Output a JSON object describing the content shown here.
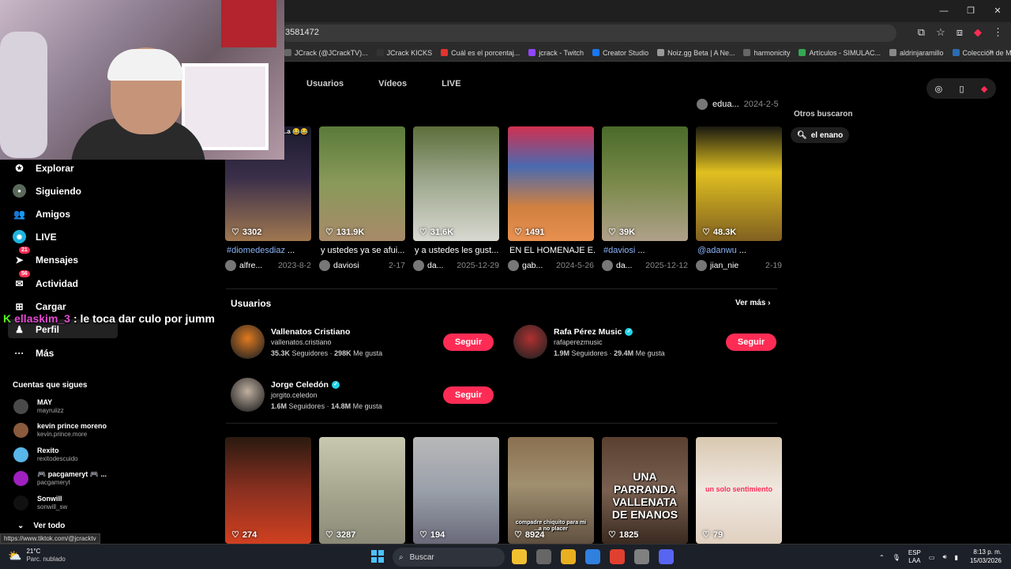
{
  "browser": {
    "url": "3581472",
    "bookmarks": [
      "JCrack (@JCrackTV)...",
      "JCrack KICKS",
      "Cuál es el porcentaj...",
      "jcrack - Twitch",
      "Creator Studio",
      "Noiz.gg Beta | A Ne...",
      "harmonicity",
      "Artículos - SIMULAC...",
      "aldrinjaramillo",
      "Colección de M_blei..."
    ],
    "bookmark_colors": [
      "#666666",
      "#333333",
      "#e3342f",
      "#9146ff",
      "#1877f2",
      "#999999",
      "#666666",
      "#34a853",
      "#888888",
      "#2b6cb0"
    ],
    "more_label": "»",
    "window_controls": [
      "—",
      "❐",
      "✕"
    ]
  },
  "tabs": [
    "Usuarios",
    "Vídeos",
    "LIVE"
  ],
  "prev_row": {
    "user": "edua...",
    "date": "2024-2-5"
  },
  "others": {
    "title": "Otros buscaron",
    "chip": "el enano"
  },
  "sidebar": {
    "items": [
      {
        "icon": "compass-icon",
        "glyph": "✪",
        "label": "Explorar",
        "badge": ""
      },
      {
        "icon": "following-avatar-icon",
        "glyph": "●",
        "label": "Siguiendo",
        "badge": ""
      },
      {
        "icon": "friends-icon",
        "glyph": "👥",
        "label": "Amigos",
        "badge": ""
      },
      {
        "icon": "live-icon",
        "glyph": "◉",
        "label": "LIVE",
        "badge": ""
      },
      {
        "icon": "messages-icon",
        "glyph": "➤",
        "label": "Mensajes",
        "badge": "21"
      },
      {
        "icon": "activity-icon",
        "glyph": "✉",
        "label": "Actividad",
        "badge": "56"
      },
      {
        "icon": "upload-icon",
        "glyph": "⊞",
        "label": "Cargar",
        "badge": ""
      },
      {
        "icon": "profile-icon",
        "glyph": "♟",
        "label": "Perfil",
        "badge": ""
      },
      {
        "icon": "more-icon",
        "glyph": "···",
        "label": "Más",
        "badge": ""
      }
    ],
    "following_title": "Cuentas que sigues",
    "accounts": [
      {
        "name": "MAY",
        "handle": "mayruiizz",
        "color": "#4a4a4a"
      },
      {
        "name": "kevin prince moreno",
        "handle": "kevin.prince.more",
        "color": "#8a5a3c"
      },
      {
        "name": "Rexito",
        "handle": "rexitodescuido",
        "color": "#59b6e8"
      },
      {
        "name": "🎮 pacgameryt 🎮 ...",
        "handle": "pacgameryt",
        "color": "#a020c0"
      },
      {
        "name": "Sonwill",
        "handle": "sonwill_sw",
        "color": "#111111"
      }
    ],
    "see_all": "Ver todo"
  },
  "chat": {
    "k": "K",
    "user": "ellaskim_3",
    "message": ": le toca dar culo por jumm"
  },
  "status_url": "https://www.tiktok.com/@jcracktv",
  "videos_row1": [
    {
      "likes": "3302",
      "caption_tag": "#diomedesdiaz",
      "caption": " ...",
      "user": "alfre...",
      "date": "2023-8-2",
      "bg": "linear-gradient(180deg,#1a1a2e 0%,#3b2f4a 45%,#a07850 100%)",
      "overlay": "...curas, ...a 😂😂"
    },
    {
      "likes": "131.9K",
      "caption_tag": "",
      "caption": "y ustedes ya se afui...",
      "user": "daviosi",
      "date": "2-17",
      "bg": "linear-gradient(180deg,#5a7a3a 0%,#8a9a5a 50%,#a88a6a 100%)",
      "overlay": ""
    },
    {
      "likes": "31.6K",
      "caption_tag": "",
      "caption": "y a ustedes les gust...",
      "user": "da...",
      "date": "2025-12-29",
      "bg": "linear-gradient(180deg,#5e6e3a 0%,#9aa58a 45%,#d8d8d0 100%)",
      "overlay": ""
    },
    {
      "likes": "1491",
      "caption_tag": "",
      "caption": "EN EL HOMENAJE E...",
      "user": "gab...",
      "date": "2024-5-26",
      "bg": "linear-gradient(180deg,#d03050 0%,#4a6ab0 35%,#d08040 70%,#e89050 100%)",
      "overlay": ""
    },
    {
      "likes": "39K",
      "caption_tag": "#daviosi",
      "caption": " ...",
      "user": "da...",
      "date": "2025-12-12",
      "bg": "linear-gradient(180deg,#4a6a2a 0%,#7a8a4a 50%,#b0a08a 100%)",
      "overlay": ""
    },
    {
      "likes": "48.3K",
      "caption_tag": "@adanwu",
      "caption": " ...",
      "user": "jian_nie",
      "date": "2-19",
      "bg": "linear-gradient(180deg,#1a1a10 0%,#e0c020 40%,#806020 100%)",
      "overlay": ""
    }
  ],
  "users_section": {
    "title": "Usuarios",
    "see_more": "Ver más",
    "follow_label": "Seguir",
    "users": [
      {
        "name": "Vallenatos Cristiano",
        "handle": "vallenatos.cristiano",
        "followers": "35.3K",
        "followers_label": "Seguidores",
        "likes": "298K",
        "likes_label": "Me gusta",
        "verified": false,
        "color": "#e07a20"
      },
      {
        "name": "Rafa Pérez Music",
        "handle": "rafaperezmusic",
        "followers": "1.9M",
        "followers_label": "Seguidores",
        "likes": "29.4M",
        "likes_label": "Me gusta",
        "verified": true,
        "color": "#b03030"
      },
      {
        "name": "Jorge Celedón",
        "handle": "jorgito.celedon",
        "followers": "1.6M",
        "followers_label": "Seguidores",
        "likes": "14.8M",
        "likes_label": "Me gusta",
        "verified": true,
        "color": "#c0b0a0"
      }
    ]
  },
  "videos_row2": [
    {
      "likes": "274",
      "bg": "linear-gradient(180deg,#2a1a10 0%,#8a3020 50%,#d04020 100%)",
      "overlay": ""
    },
    {
      "likes": "3287",
      "bg": "linear-gradient(180deg,#c8c8b0 0%,#a8a890 50%,#8a8a78 100%)",
      "overlay": ""
    },
    {
      "likes": "194",
      "bg": "linear-gradient(180deg,#b8b8b8 0%,#9aa0aa 50%,#6a6a7a 100%)",
      "overlay": ""
    },
    {
      "likes": "8924",
      "bg": "linear-gradient(180deg,#8a7050 0%,#a09070 45%,#605040 100%)",
      "overlay": "compadre chiquito para mi ...a no placer"
    },
    {
      "likes": "1825",
      "bg": "linear-gradient(180deg,#5a4030 0%,#7a6050 50%,#3a2a20 100%)",
      "overlay": "UNA PARRANDA VALLENATA DE ENANOS"
    },
    {
      "likes": "79",
      "bg": "linear-gradient(180deg,#d8c8b0 0%,#f0e8e0 50%,#e0d0c0 100%)",
      "overlay": "un solo sentimiento"
    }
  ],
  "taskbar": {
    "temp": "21°C",
    "weather": "Parc. nublado",
    "search": "Buscar",
    "app_colors": [
      "#f0c030",
      "#666666",
      "#e8b020",
      "#3080e0",
      "#e04030",
      "#808080",
      "#5865f2"
    ],
    "lang1": "ESP",
    "lang2": "LAA",
    "time": "8:13 p. m.",
    "date": "15/03/2026"
  }
}
